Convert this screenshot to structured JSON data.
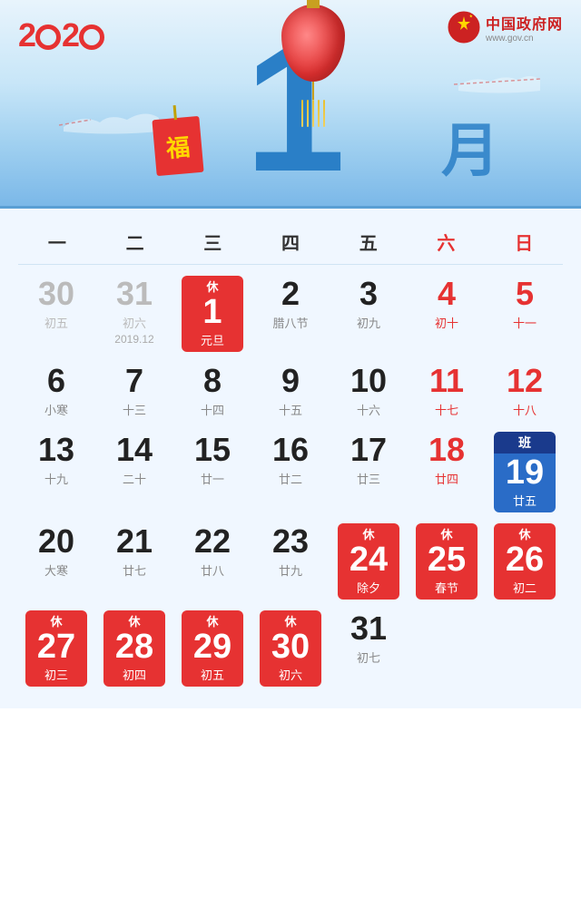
{
  "header": {
    "year": "2020",
    "month": "1",
    "yue": "月",
    "gov_name": "中国政府网",
    "gov_url": "www.gov.cn",
    "fu": "福"
  },
  "weekdays": [
    {
      "label": "一",
      "weekend": false
    },
    {
      "label": "二",
      "weekend": false
    },
    {
      "label": "三",
      "weekend": false
    },
    {
      "label": "四",
      "weekend": false
    },
    {
      "label": "五",
      "weekend": false
    },
    {
      "label": "六",
      "weekend": true
    },
    {
      "label": "日",
      "weekend": true
    }
  ],
  "legend": {
    "xiu": "休",
    "ban": "班"
  },
  "days": [
    {
      "num": "30",
      "lunar": "初五",
      "type": "prev-month",
      "col": 1
    },
    {
      "num": "31",
      "lunar": "初六",
      "type": "prev-month",
      "col": 2
    },
    {
      "num": "1",
      "lunar": "元旦",
      "type": "holiday-yuandan",
      "col": 3
    },
    {
      "num": "2",
      "lunar": "腊八节",
      "type": "normal",
      "col": 4
    },
    {
      "num": "3",
      "lunar": "初九",
      "type": "normal",
      "col": 5
    },
    {
      "num": "4",
      "lunar": "初十",
      "type": "weekend",
      "col": 6
    },
    {
      "num": "5",
      "lunar": "十一",
      "type": "weekend",
      "col": 7
    },
    {
      "num": "6",
      "lunar": "小寒",
      "type": "normal",
      "col": 1
    },
    {
      "num": "7",
      "lunar": "十三",
      "type": "normal",
      "col": 2
    },
    {
      "num": "8",
      "lunar": "十四",
      "type": "normal",
      "col": 3
    },
    {
      "num": "9",
      "lunar": "十五",
      "type": "normal",
      "col": 4
    },
    {
      "num": "10",
      "lunar": "十六",
      "type": "normal",
      "col": 5
    },
    {
      "num": "11",
      "lunar": "十七",
      "type": "weekend",
      "col": 6
    },
    {
      "num": "12",
      "lunar": "十八",
      "type": "weekend",
      "col": 7
    },
    {
      "num": "13",
      "lunar": "十九",
      "type": "normal",
      "col": 1
    },
    {
      "num": "14",
      "lunar": "二十",
      "type": "normal",
      "col": 2
    },
    {
      "num": "15",
      "lunar": "廿一",
      "type": "normal",
      "col": 3
    },
    {
      "num": "16",
      "lunar": "廿二",
      "type": "normal",
      "col": 4
    },
    {
      "num": "17",
      "lunar": "廿三",
      "type": "normal",
      "col": 5
    },
    {
      "num": "18",
      "lunar": "廿四",
      "type": "weekend",
      "col": 6
    },
    {
      "num": "19",
      "lunar": "廿五",
      "type": "work-day",
      "col": 7
    },
    {
      "num": "20",
      "lunar": "大寒",
      "type": "normal",
      "col": 1
    },
    {
      "num": "21",
      "lunar": "廿七",
      "type": "normal",
      "col": 2
    },
    {
      "num": "22",
      "lunar": "廿八",
      "type": "normal",
      "col": 3
    },
    {
      "num": "23",
      "lunar": "廿九",
      "type": "normal",
      "col": 4
    },
    {
      "num": "24",
      "lunar": "除夕",
      "type": "holiday",
      "col": 5
    },
    {
      "num": "25",
      "lunar": "春节",
      "type": "holiday",
      "col": 6
    },
    {
      "num": "26",
      "lunar": "初二",
      "type": "holiday",
      "col": 7
    },
    {
      "num": "27",
      "lunar": "初三",
      "type": "holiday",
      "col": 1
    },
    {
      "num": "28",
      "lunar": "初四",
      "type": "holiday",
      "col": 2
    },
    {
      "num": "29",
      "lunar": "初五",
      "type": "holiday",
      "col": 3
    },
    {
      "num": "30",
      "lunar": "初六",
      "type": "holiday",
      "col": 4
    },
    {
      "num": "31",
      "lunar": "初七",
      "type": "normal",
      "col": 5
    }
  ]
}
